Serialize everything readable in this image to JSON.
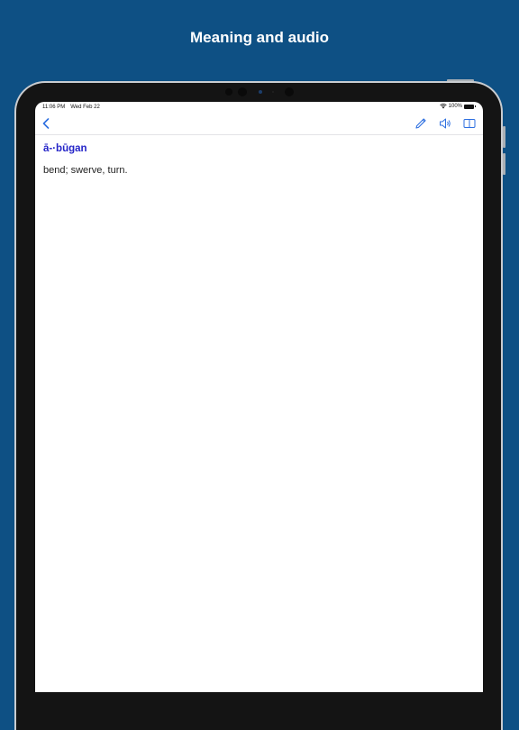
{
  "promo": {
    "title": "Meaning and audio"
  },
  "status_bar": {
    "time": "11:06 PM",
    "date": "Wed Feb 22",
    "battery": "100%",
    "icons": [
      "wifi-icon",
      "battery-icon"
    ]
  },
  "nav_bar": {
    "back_icon": "chevron-left-icon",
    "actions": [
      {
        "name": "edit",
        "icon": "pencil-icon"
      },
      {
        "name": "audio",
        "icon": "speaker-icon"
      },
      {
        "name": "book",
        "icon": "book-icon"
      }
    ]
  },
  "entry": {
    "headword": "ā-·būgan",
    "definition": "bend; swerve, turn."
  },
  "colors": {
    "background": "#0e5084",
    "accent": "#2d6fe0",
    "headword": "#2424c8"
  }
}
